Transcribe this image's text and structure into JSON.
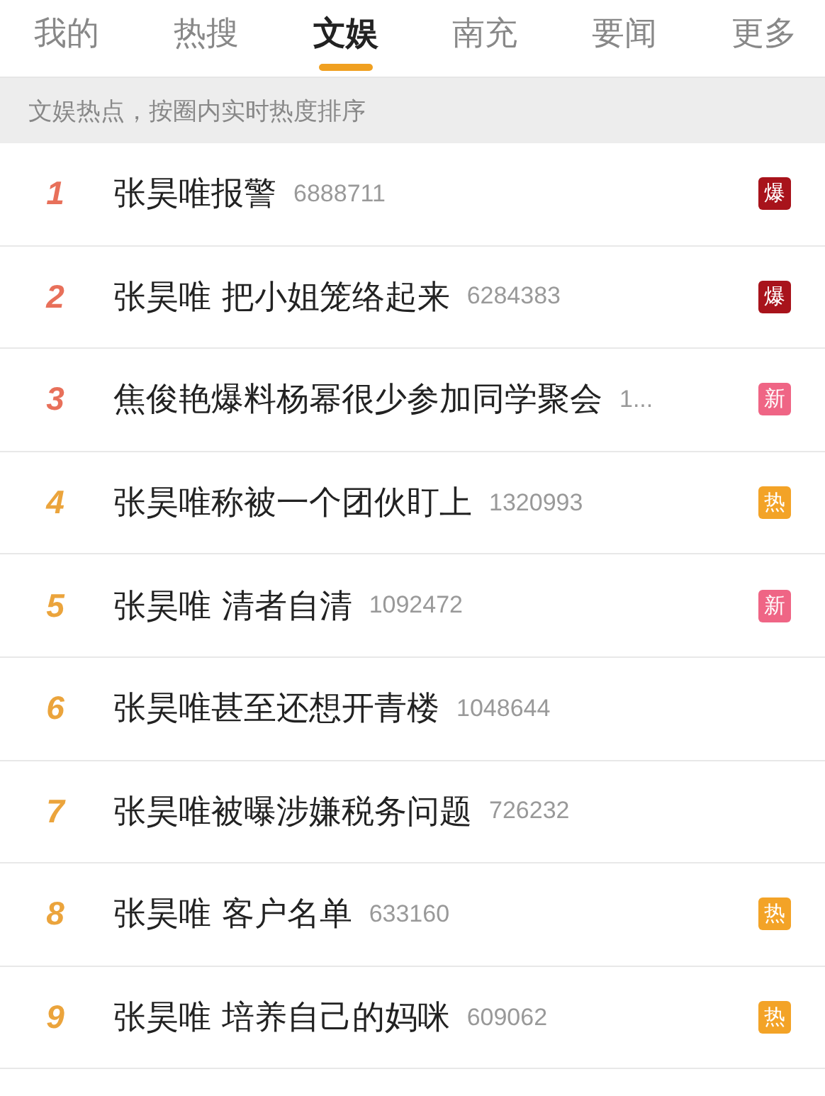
{
  "tabs": [
    {
      "label": "我的",
      "selected": false
    },
    {
      "label": "热搜",
      "selected": false
    },
    {
      "label": "文娱",
      "selected": true
    },
    {
      "label": "南充",
      "selected": false
    },
    {
      "label": "要闻",
      "selected": false
    },
    {
      "label": "更多",
      "selected": false
    }
  ],
  "subtitle": "文娱热点，按圈内实时热度排序",
  "items": [
    {
      "rank": "1",
      "color": "#e8705a",
      "title": "张昊唯报警",
      "count": "6888711",
      "badge": {
        "label": "爆",
        "color": "#a8131b"
      }
    },
    {
      "rank": "2",
      "color": "#e8705a",
      "title": "张昊唯 把小姐笼络起来",
      "count": "6284383",
      "badge": {
        "label": "爆",
        "color": "#a8131b"
      }
    },
    {
      "rank": "3",
      "color": "#e8705a",
      "title": "焦俊艳爆料杨幂很少参加同学聚会",
      "count": "1...",
      "badge": {
        "label": "新",
        "color": "#ef6585"
      }
    },
    {
      "rank": "4",
      "color": "#eba43c",
      "title": "张昊唯称被一个团伙盯上",
      "count": "1320993",
      "badge": {
        "label": "热",
        "color": "#f3a327"
      }
    },
    {
      "rank": "5",
      "color": "#eba43c",
      "title": "张昊唯 清者自清",
      "count": "1092472",
      "badge": {
        "label": "新",
        "color": "#ef6585"
      }
    },
    {
      "rank": "6",
      "color": "#eba43c",
      "title": "张昊唯甚至还想开青楼",
      "count": "1048644"
    },
    {
      "rank": "7",
      "color": "#eba43c",
      "title": "张昊唯被曝涉嫌税务问题",
      "count": "726232"
    },
    {
      "rank": "8",
      "color": "#eba43c",
      "title": "张昊唯 客户名单",
      "count": "633160",
      "badge": {
        "label": "热",
        "color": "#f3a327"
      }
    },
    {
      "rank": "9",
      "color": "#eba43c",
      "title": "张昊唯 培养自己的妈咪",
      "count": "609062",
      "badge": {
        "label": "热",
        "color": "#f3a327"
      }
    }
  ]
}
